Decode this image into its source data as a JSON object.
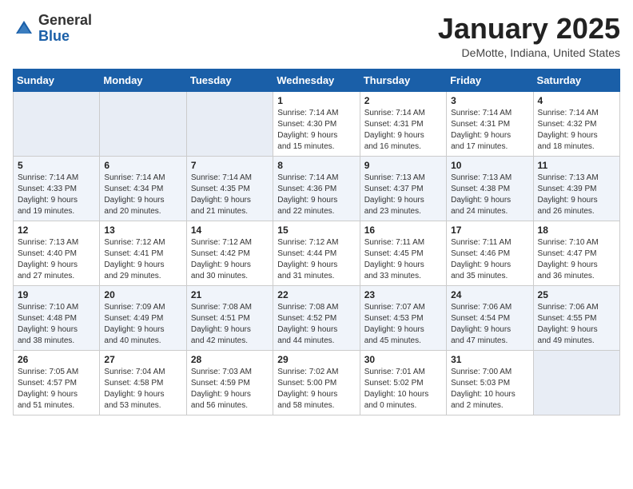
{
  "header": {
    "logo_general": "General",
    "logo_blue": "Blue",
    "title": "January 2025",
    "subtitle": "DeMotte, Indiana, United States"
  },
  "weekdays": [
    "Sunday",
    "Monday",
    "Tuesday",
    "Wednesday",
    "Thursday",
    "Friday",
    "Saturday"
  ],
  "weeks": [
    [
      {
        "num": "",
        "info": ""
      },
      {
        "num": "",
        "info": ""
      },
      {
        "num": "",
        "info": ""
      },
      {
        "num": "1",
        "info": "Sunrise: 7:14 AM\nSunset: 4:30 PM\nDaylight: 9 hours\nand 15 minutes."
      },
      {
        "num": "2",
        "info": "Sunrise: 7:14 AM\nSunset: 4:31 PM\nDaylight: 9 hours\nand 16 minutes."
      },
      {
        "num": "3",
        "info": "Sunrise: 7:14 AM\nSunset: 4:31 PM\nDaylight: 9 hours\nand 17 minutes."
      },
      {
        "num": "4",
        "info": "Sunrise: 7:14 AM\nSunset: 4:32 PM\nDaylight: 9 hours\nand 18 minutes."
      }
    ],
    [
      {
        "num": "5",
        "info": "Sunrise: 7:14 AM\nSunset: 4:33 PM\nDaylight: 9 hours\nand 19 minutes."
      },
      {
        "num": "6",
        "info": "Sunrise: 7:14 AM\nSunset: 4:34 PM\nDaylight: 9 hours\nand 20 minutes."
      },
      {
        "num": "7",
        "info": "Sunrise: 7:14 AM\nSunset: 4:35 PM\nDaylight: 9 hours\nand 21 minutes."
      },
      {
        "num": "8",
        "info": "Sunrise: 7:14 AM\nSunset: 4:36 PM\nDaylight: 9 hours\nand 22 minutes."
      },
      {
        "num": "9",
        "info": "Sunrise: 7:13 AM\nSunset: 4:37 PM\nDaylight: 9 hours\nand 23 minutes."
      },
      {
        "num": "10",
        "info": "Sunrise: 7:13 AM\nSunset: 4:38 PM\nDaylight: 9 hours\nand 24 minutes."
      },
      {
        "num": "11",
        "info": "Sunrise: 7:13 AM\nSunset: 4:39 PM\nDaylight: 9 hours\nand 26 minutes."
      }
    ],
    [
      {
        "num": "12",
        "info": "Sunrise: 7:13 AM\nSunset: 4:40 PM\nDaylight: 9 hours\nand 27 minutes."
      },
      {
        "num": "13",
        "info": "Sunrise: 7:12 AM\nSunset: 4:41 PM\nDaylight: 9 hours\nand 29 minutes."
      },
      {
        "num": "14",
        "info": "Sunrise: 7:12 AM\nSunset: 4:42 PM\nDaylight: 9 hours\nand 30 minutes."
      },
      {
        "num": "15",
        "info": "Sunrise: 7:12 AM\nSunset: 4:44 PM\nDaylight: 9 hours\nand 31 minutes."
      },
      {
        "num": "16",
        "info": "Sunrise: 7:11 AM\nSunset: 4:45 PM\nDaylight: 9 hours\nand 33 minutes."
      },
      {
        "num": "17",
        "info": "Sunrise: 7:11 AM\nSunset: 4:46 PM\nDaylight: 9 hours\nand 35 minutes."
      },
      {
        "num": "18",
        "info": "Sunrise: 7:10 AM\nSunset: 4:47 PM\nDaylight: 9 hours\nand 36 minutes."
      }
    ],
    [
      {
        "num": "19",
        "info": "Sunrise: 7:10 AM\nSunset: 4:48 PM\nDaylight: 9 hours\nand 38 minutes."
      },
      {
        "num": "20",
        "info": "Sunrise: 7:09 AM\nSunset: 4:49 PM\nDaylight: 9 hours\nand 40 minutes."
      },
      {
        "num": "21",
        "info": "Sunrise: 7:08 AM\nSunset: 4:51 PM\nDaylight: 9 hours\nand 42 minutes."
      },
      {
        "num": "22",
        "info": "Sunrise: 7:08 AM\nSunset: 4:52 PM\nDaylight: 9 hours\nand 44 minutes."
      },
      {
        "num": "23",
        "info": "Sunrise: 7:07 AM\nSunset: 4:53 PM\nDaylight: 9 hours\nand 45 minutes."
      },
      {
        "num": "24",
        "info": "Sunrise: 7:06 AM\nSunset: 4:54 PM\nDaylight: 9 hours\nand 47 minutes."
      },
      {
        "num": "25",
        "info": "Sunrise: 7:06 AM\nSunset: 4:55 PM\nDaylight: 9 hours\nand 49 minutes."
      }
    ],
    [
      {
        "num": "26",
        "info": "Sunrise: 7:05 AM\nSunset: 4:57 PM\nDaylight: 9 hours\nand 51 minutes."
      },
      {
        "num": "27",
        "info": "Sunrise: 7:04 AM\nSunset: 4:58 PM\nDaylight: 9 hours\nand 53 minutes."
      },
      {
        "num": "28",
        "info": "Sunrise: 7:03 AM\nSunset: 4:59 PM\nDaylight: 9 hours\nand 56 minutes."
      },
      {
        "num": "29",
        "info": "Sunrise: 7:02 AM\nSunset: 5:00 PM\nDaylight: 9 hours\nand 58 minutes."
      },
      {
        "num": "30",
        "info": "Sunrise: 7:01 AM\nSunset: 5:02 PM\nDaylight: 10 hours\nand 0 minutes."
      },
      {
        "num": "31",
        "info": "Sunrise: 7:00 AM\nSunset: 5:03 PM\nDaylight: 10 hours\nand 2 minutes."
      },
      {
        "num": "",
        "info": ""
      }
    ]
  ]
}
